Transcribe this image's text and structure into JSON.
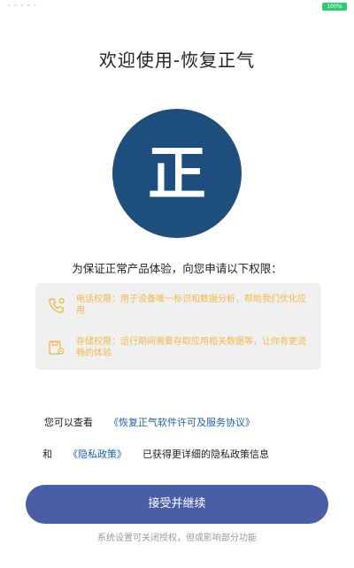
{
  "status_bar": {
    "left_text": "• • • • •",
    "battery_label": "100%"
  },
  "title": "欢迎使用-恢复正气",
  "logo": {
    "char": "正",
    "bg_color": "#1e4e7d"
  },
  "subtitle": "为保证正常产品体验，向您申请以下权限：",
  "permissions": [
    {
      "icon": "phone-icon",
      "text": "电话权限：用于设备唯一标识和数据分析，帮助我们优化应用"
    },
    {
      "icon": "storage-icon",
      "text": "存储权限：运行期间需要存取应用相关数据等，让你有更流畅的体验"
    }
  ],
  "agreement": {
    "prefix": "您可以查看",
    "link": "《恢复正气软件许可及服务协议》"
  },
  "privacy": {
    "prefix": "和",
    "link": "《隐私政策》",
    "suffix": "已获得更详细的隐私政策信息"
  },
  "accept_button": "接受并继续",
  "footer_note": "系统设置可关闭授权，但或影响部分功能",
  "colors": {
    "accent": "#4a5ea8",
    "link": "#1f5fa6",
    "permission_text": "#f2b84a"
  }
}
